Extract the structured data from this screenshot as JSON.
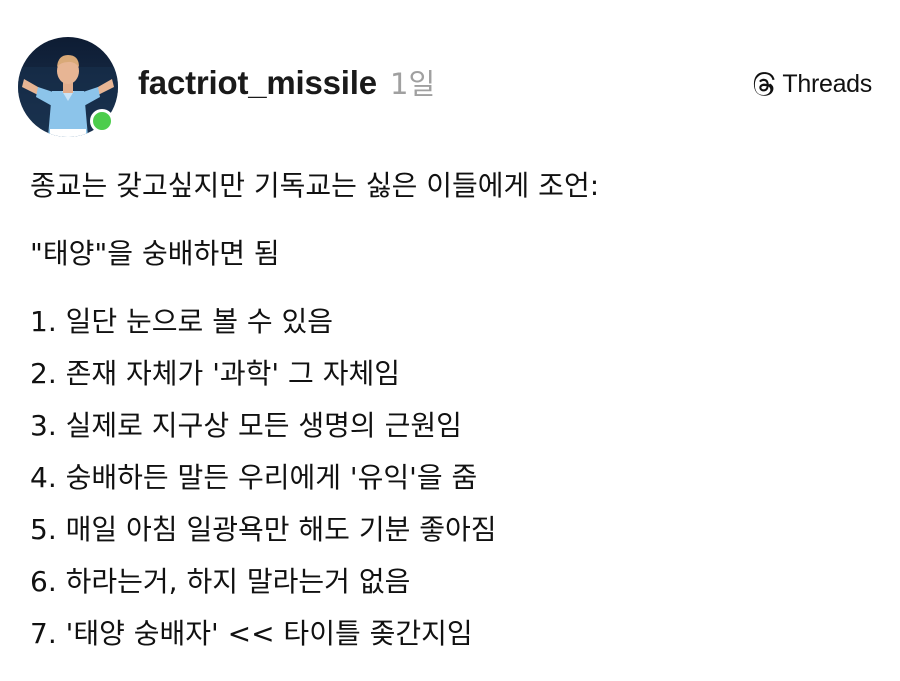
{
  "author": {
    "username": "factriot_missile",
    "post_time": "1일",
    "avatar_icon": "profile-photo",
    "status_color": "#4ccd4c"
  },
  "brand": {
    "name": "Threads",
    "icon": "threads-logo-icon"
  },
  "post": {
    "intro": "종교는 갖고싶지만 기독교는 싫은 이들에게 조언:",
    "headline": "\"태양\"을 숭배하면 됨",
    "items": [
      "1. 일단 눈으로 볼 수 있음",
      "2. 존재 자체가 '과학' 그 자체임",
      "3. 실제로 지구상 모든 생명의 근원임",
      "4. 숭배하든 말든 우리에게 '유익'을 줌",
      "5. 매일 아침 일광욕만 해도 기분 좋아짐",
      "6. 하라는거, 하지 말라는거 없음",
      "7. '태양 숭배자' << 타이틀 좆간지임"
    ]
  }
}
